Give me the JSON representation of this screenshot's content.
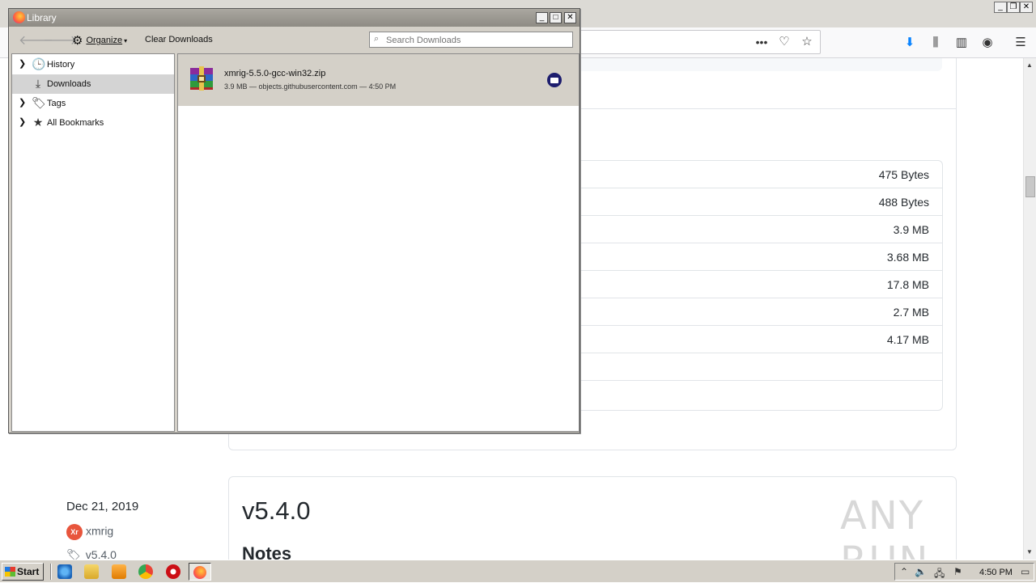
{
  "browser": {
    "assets": [
      {
        "size": "475 Bytes"
      },
      {
        "size": "488 Bytes"
      },
      {
        "size": "3.9 MB"
      },
      {
        "size": "3.68 MB"
      },
      {
        "size": "17.8 MB"
      },
      {
        "size": "2.7 MB"
      },
      {
        "size": "4.17 MB"
      },
      {
        "size": ""
      }
    ],
    "release": {
      "date": "Dec 21, 2019",
      "author": "xmrig",
      "author_avatar": "Xr",
      "tag": "v5.4.0",
      "title": "v5.4.0",
      "notes_heading": "Notes"
    },
    "watermark": "ANY RUN",
    "toolbar_icons": [
      "more-icon",
      "pocket-icon",
      "bookmark-star-icon",
      "downloads-icon",
      "library-icon",
      "sidebar-icon",
      "account-icon",
      "menu-icon"
    ]
  },
  "library": {
    "title": "Library",
    "toolbar": {
      "organize_label": "Organize",
      "clear_label": "Clear Downloads",
      "search_placeholder": "Search Downloads"
    },
    "sidebar": [
      {
        "label": "History",
        "icon": "clock-icon",
        "expandable": true
      },
      {
        "label": "Downloads",
        "icon": "download-icon",
        "expandable": false,
        "selected": true
      },
      {
        "label": "Tags",
        "icon": "tag-icon",
        "expandable": true
      },
      {
        "label": "All Bookmarks",
        "icon": "star-icon",
        "expandable": true
      }
    ],
    "downloads": [
      {
        "name": "xmrig-5.5.0-gcc-win32.zip",
        "status": "3.9 MB — objects.githubusercontent.com — 4:50 PM",
        "icon": "winrar-archive-icon"
      }
    ]
  },
  "taskbar": {
    "start_label": "Start",
    "clock": "4:50 PM"
  }
}
